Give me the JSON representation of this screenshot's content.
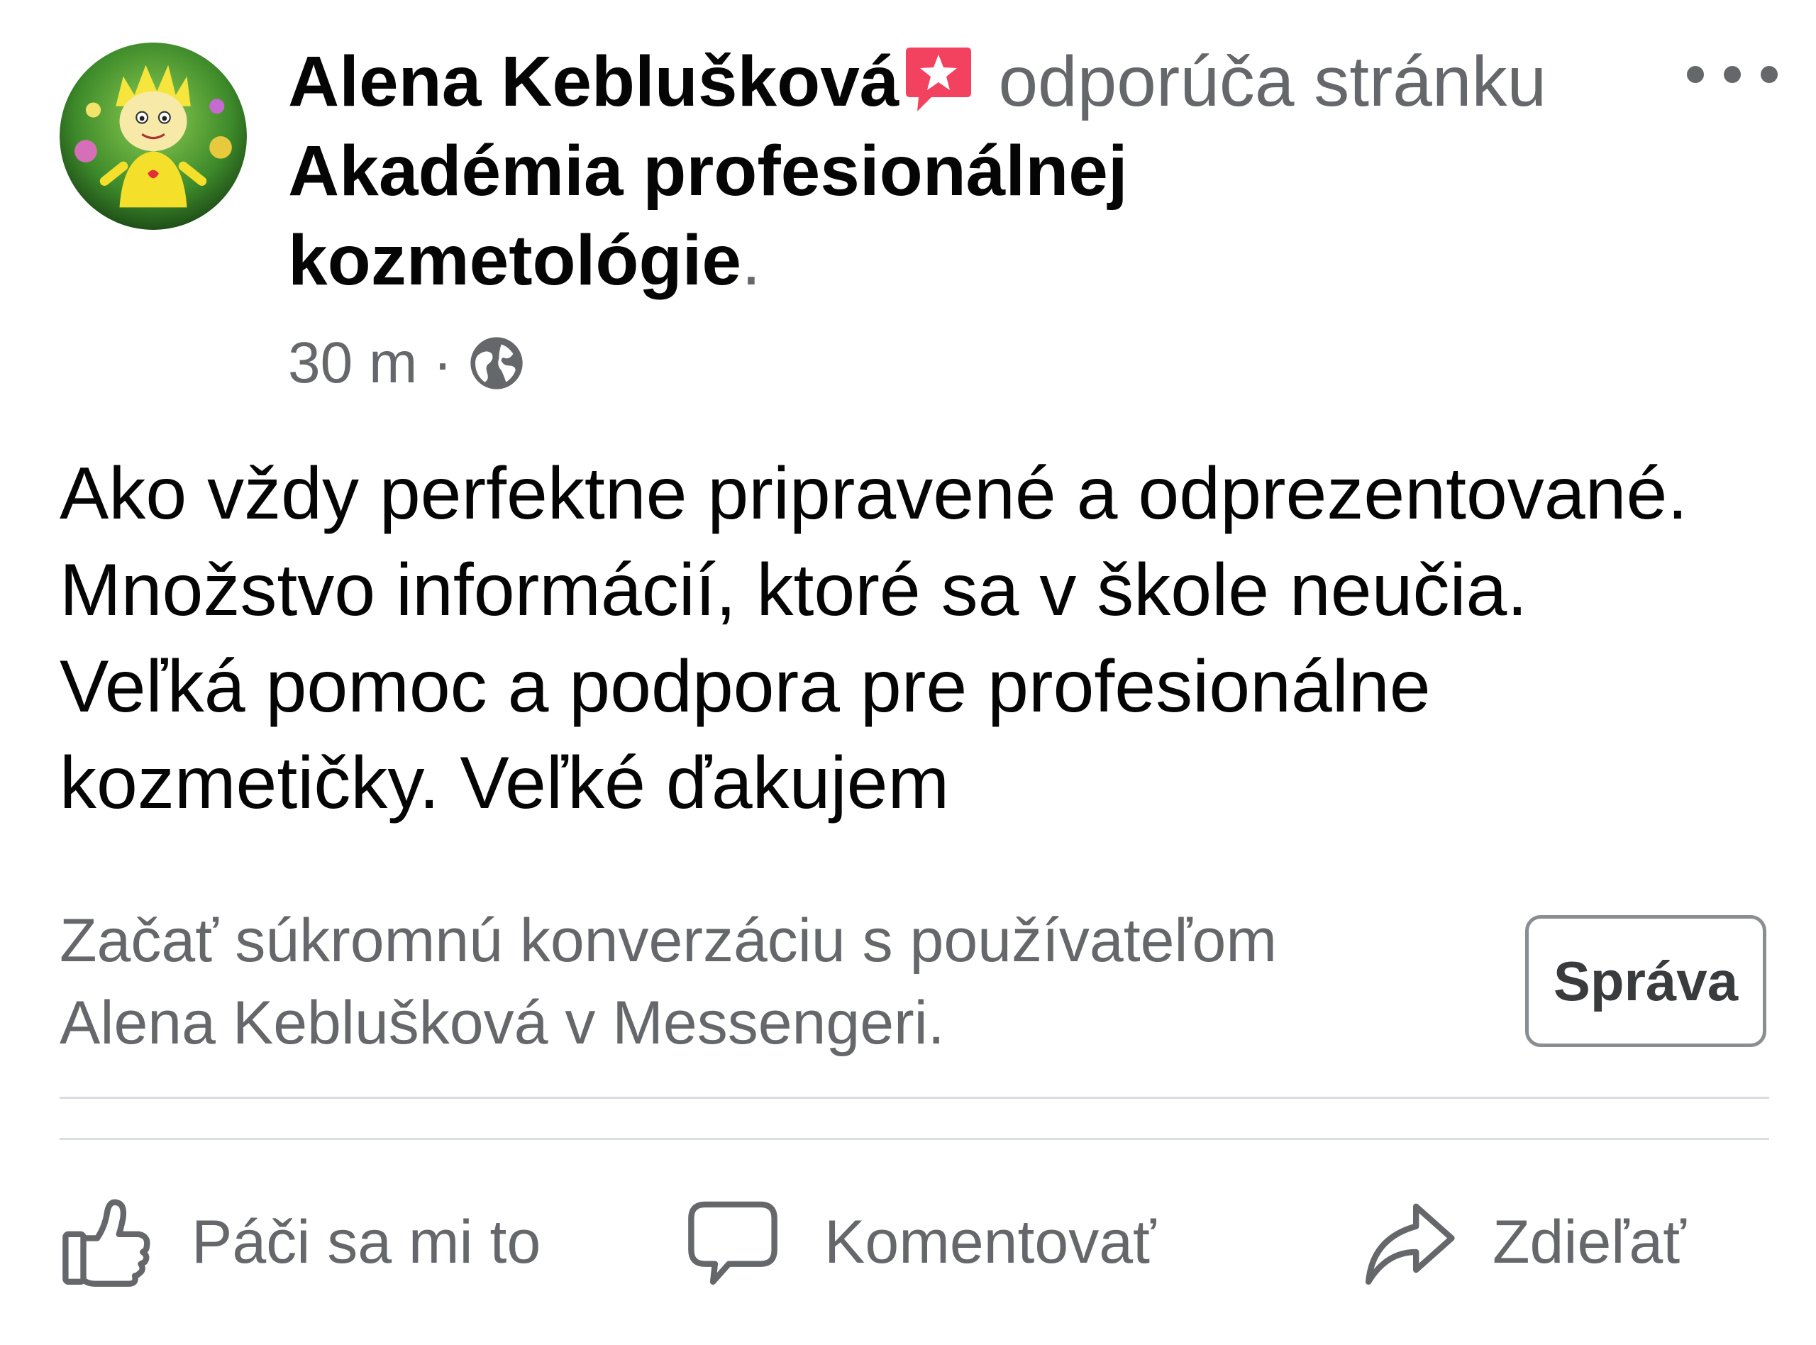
{
  "post": {
    "author": {
      "name": "Alena Keblušková",
      "avatar_icon": "cartoon-child-avatar"
    },
    "recommendation": {
      "badge_icon": "recommend-star-speech-icon",
      "badge_color": "#f3425f",
      "verb_text": "odporúča stránku",
      "page_name_line1": "Akadémia profesionálnej",
      "page_name_line2": "kozmetológie",
      "end_punctuation": "."
    },
    "meta": {
      "timestamp": "30 m",
      "separator": "·",
      "audience_icon": "globe-icon"
    },
    "more_icon": "more-options-icon",
    "text_lines": [
      "Ako vždy perfektne pripravené a odprezentované.",
      "Množstvo informácií, ktoré sa v škole neučia.",
      "Veľká pomoc a podpora pre profesionálne",
      "kozmetičky. Veľké ďakujem"
    ]
  },
  "messenger": {
    "prompt_line1": "Začať súkromnú konverzáciu s používateľom",
    "prompt_line2": "Alena Keblušková v Messengeri.",
    "button_label": "Správa"
  },
  "actions": {
    "like": {
      "label": "Páči sa mi to",
      "icon": "thumbs-up-icon"
    },
    "comment": {
      "label": "Komentovať",
      "icon": "comment-bubble-icon"
    },
    "share": {
      "label": "Zdieľať",
      "icon": "share-arrow-icon"
    }
  },
  "colors": {
    "primary_text": "#050505",
    "secondary_text": "#65676b",
    "divider": "#dadde1",
    "recommend_badge": "#f3425f"
  }
}
